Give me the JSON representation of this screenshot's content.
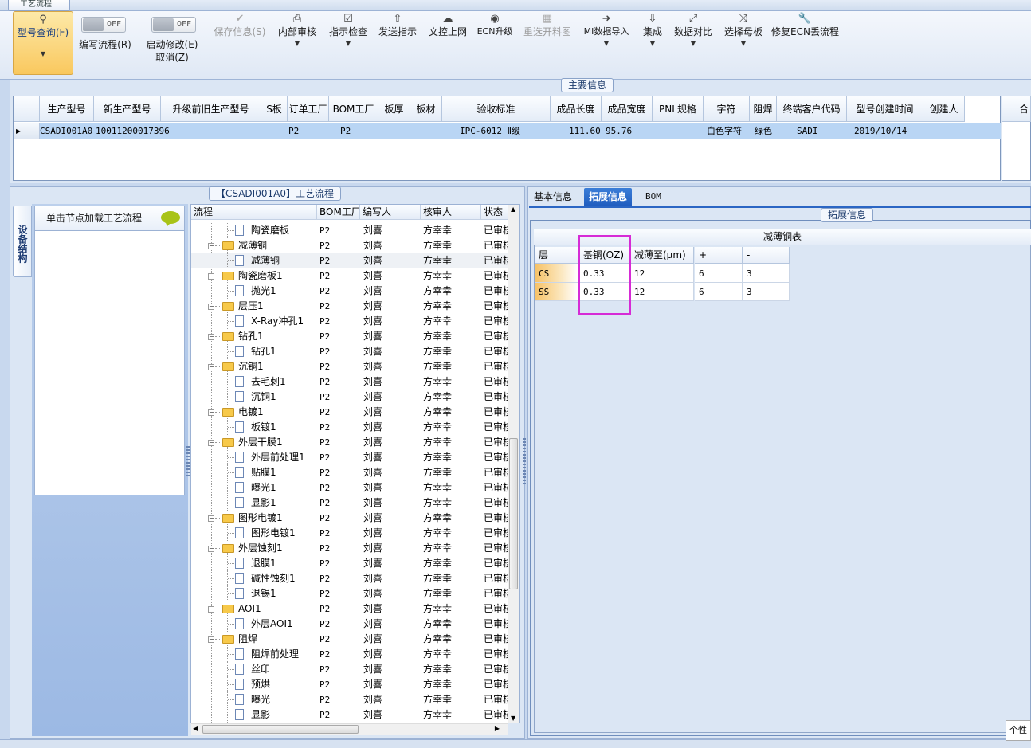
{
  "window": {
    "tab_title": "工艺流程"
  },
  "toolbar": {
    "query": {
      "label": "型号查询(F)"
    },
    "write_toggle": {
      "state": "OFF",
      "label": "编写流程(R)"
    },
    "modify_toggle": {
      "state": "OFF",
      "label": "启动修改(E)",
      "sub": "取消(Z)"
    },
    "save": {
      "label": "保存信息(S)"
    },
    "audit": {
      "label": "内部审核"
    },
    "check": {
      "label": "指示检查"
    },
    "send": {
      "label": "发送指示"
    },
    "upload": {
      "label": "文控上网"
    },
    "ecn": {
      "label": "ECN升级"
    },
    "reselect": {
      "label": "重选开料图"
    },
    "mi_import": {
      "label": "MI数据导入"
    },
    "integrate": {
      "label": "集成"
    },
    "compare": {
      "label": "数据对比"
    },
    "mother": {
      "label": "选择母板"
    },
    "fix": {
      "label": "修复ECN丢流程"
    }
  },
  "main_info": {
    "title": "主要信息",
    "columns": [
      "生产型号",
      "新生产型号",
      "升级前旧生产型号",
      "S板",
      "订单工厂",
      "BOM工厂",
      "板厚",
      "板材",
      "验收标准",
      "成品长度",
      "成品宽度",
      "PNL规格",
      "字符",
      "阻焊",
      "终端客户代码",
      "型号创建时间",
      "创建人"
    ],
    "row": [
      "CSADI001A0",
      "10011200017396",
      "",
      "",
      "P2",
      "P2",
      "",
      "",
      "IPC-6012 Ⅱ级",
      "111.60",
      "95.76",
      "",
      "白色字符",
      "绿色",
      "SADI",
      "2019/10/14",
      ""
    ],
    "right_header": "合"
  },
  "process": {
    "title": "【CSADI001A0】工艺流程",
    "side_tab": "设备结构",
    "node_hint": "单击节点加载工艺流程",
    "columns": [
      "流程",
      "BOM工厂",
      "编写人",
      "核审人",
      "状态"
    ],
    "rows": [
      {
        "name": "陶瓷磨板",
        "level": 2,
        "bom": "P2",
        "writer": "刘喜",
        "reviewer": "方幸幸",
        "status": "已审核"
      },
      {
        "name": "减薄铜",
        "level": 1,
        "bom": "P2",
        "writer": "刘喜",
        "reviewer": "方幸幸",
        "status": "已审核"
      },
      {
        "name": "减薄铜",
        "level": 2,
        "bom": "P2",
        "writer": "刘喜",
        "reviewer": "方幸幸",
        "status": "已审核"
      },
      {
        "name": "陶瓷磨板1",
        "level": 1,
        "bom": "P2",
        "writer": "刘喜",
        "reviewer": "方幸幸",
        "status": "已审核"
      },
      {
        "name": "抛光1",
        "level": 2,
        "bom": "P2",
        "writer": "刘喜",
        "reviewer": "方幸幸",
        "status": "已审核"
      },
      {
        "name": "层压1",
        "level": 1,
        "bom": "P2",
        "writer": "刘喜",
        "reviewer": "方幸幸",
        "status": "已审核"
      },
      {
        "name": "X-Ray冲孔1",
        "level": 2,
        "bom": "P2",
        "writer": "刘喜",
        "reviewer": "方幸幸",
        "status": "已审核"
      },
      {
        "name": "钻孔1",
        "level": 1,
        "bom": "P2",
        "writer": "刘喜",
        "reviewer": "方幸幸",
        "status": "已审核"
      },
      {
        "name": "钻孔1",
        "level": 2,
        "bom": "P2",
        "writer": "刘喜",
        "reviewer": "方幸幸",
        "status": "已审核"
      },
      {
        "name": "沉铜1",
        "level": 1,
        "bom": "P2",
        "writer": "刘喜",
        "reviewer": "方幸幸",
        "status": "已审核"
      },
      {
        "name": "去毛刺1",
        "level": 2,
        "bom": "P2",
        "writer": "刘喜",
        "reviewer": "方幸幸",
        "status": "已审核"
      },
      {
        "name": "沉铜1",
        "level": 2,
        "bom": "P2",
        "writer": "刘喜",
        "reviewer": "方幸幸",
        "status": "已审核"
      },
      {
        "name": "电镀1",
        "level": 1,
        "bom": "P2",
        "writer": "刘喜",
        "reviewer": "方幸幸",
        "status": "已审核"
      },
      {
        "name": "板镀1",
        "level": 2,
        "bom": "P2",
        "writer": "刘喜",
        "reviewer": "方幸幸",
        "status": "已审核"
      },
      {
        "name": "外层干膜1",
        "level": 1,
        "bom": "P2",
        "writer": "刘喜",
        "reviewer": "方幸幸",
        "status": "已审核"
      },
      {
        "name": "外层前处理1",
        "level": 2,
        "bom": "P2",
        "writer": "刘喜",
        "reviewer": "方幸幸",
        "status": "已审核"
      },
      {
        "name": "贴膜1",
        "level": 2,
        "bom": "P2",
        "writer": "刘喜",
        "reviewer": "方幸幸",
        "status": "已审核"
      },
      {
        "name": "曝光1",
        "level": 2,
        "bom": "P2",
        "writer": "刘喜",
        "reviewer": "方幸幸",
        "status": "已审核"
      },
      {
        "name": "显影1",
        "level": 2,
        "bom": "P2",
        "writer": "刘喜",
        "reviewer": "方幸幸",
        "status": "已审核"
      },
      {
        "name": "图形电镀1",
        "level": 1,
        "bom": "P2",
        "writer": "刘喜",
        "reviewer": "方幸幸",
        "status": "已审核"
      },
      {
        "name": "图形电镀1",
        "level": 2,
        "bom": "P2",
        "writer": "刘喜",
        "reviewer": "方幸幸",
        "status": "已审核"
      },
      {
        "name": "外层蚀刻1",
        "level": 1,
        "bom": "P2",
        "writer": "刘喜",
        "reviewer": "方幸幸",
        "status": "已审核"
      },
      {
        "name": "退膜1",
        "level": 2,
        "bom": "P2",
        "writer": "刘喜",
        "reviewer": "方幸幸",
        "status": "已审核"
      },
      {
        "name": "碱性蚀刻1",
        "level": 2,
        "bom": "P2",
        "writer": "刘喜",
        "reviewer": "方幸幸",
        "status": "已审核"
      },
      {
        "name": "退锡1",
        "level": 2,
        "bom": "P2",
        "writer": "刘喜",
        "reviewer": "方幸幸",
        "status": "已审核"
      },
      {
        "name": "AOI1",
        "level": 1,
        "bom": "P2",
        "writer": "刘喜",
        "reviewer": "方幸幸",
        "status": "已审核"
      },
      {
        "name": "外层AOI1",
        "level": 2,
        "bom": "P2",
        "writer": "刘喜",
        "reviewer": "方幸幸",
        "status": "已审核"
      },
      {
        "name": "阻焊",
        "level": 1,
        "bom": "P2",
        "writer": "刘喜",
        "reviewer": "方幸幸",
        "status": "已审核"
      },
      {
        "name": "阻焊前处理",
        "level": 2,
        "bom": "P2",
        "writer": "刘喜",
        "reviewer": "方幸幸",
        "status": "已审核"
      },
      {
        "name": "丝印",
        "level": 2,
        "bom": "P2",
        "writer": "刘喜",
        "reviewer": "方幸幸",
        "status": "已审核"
      },
      {
        "name": "预烘",
        "level": 2,
        "bom": "P2",
        "writer": "刘喜",
        "reviewer": "方幸幸",
        "status": "已审核"
      },
      {
        "name": "曝光",
        "level": 2,
        "bom": "P2",
        "writer": "刘喜",
        "reviewer": "方幸幸",
        "status": "已审核"
      },
      {
        "name": "显影",
        "level": 2,
        "bom": "P2",
        "writer": "刘喜",
        "reviewer": "方幸幸",
        "status": "已审核"
      }
    ]
  },
  "tabs": [
    {
      "label": "基本信息"
    },
    {
      "label": "拓展信息"
    },
    {
      "label": "BOM"
    }
  ],
  "ext_info": {
    "title": "拓展信息",
    "table_title": "减薄铜表",
    "columns": [
      "层",
      "基铜(OZ)",
      "减薄至(μm)",
      "+",
      "-"
    ],
    "rows": [
      [
        "CS",
        "0.33",
        "12",
        "6",
        "3"
      ],
      [
        "SS",
        "0.33",
        "12",
        "6",
        "3"
      ]
    ]
  },
  "tooltip": {
    "text": "个性"
  },
  "colors": {
    "active_tab": "#1e5bbd",
    "highlight_box": "#d62bd6",
    "selected_row": "#b9d5f4",
    "query_button": "#f9c85e"
  }
}
